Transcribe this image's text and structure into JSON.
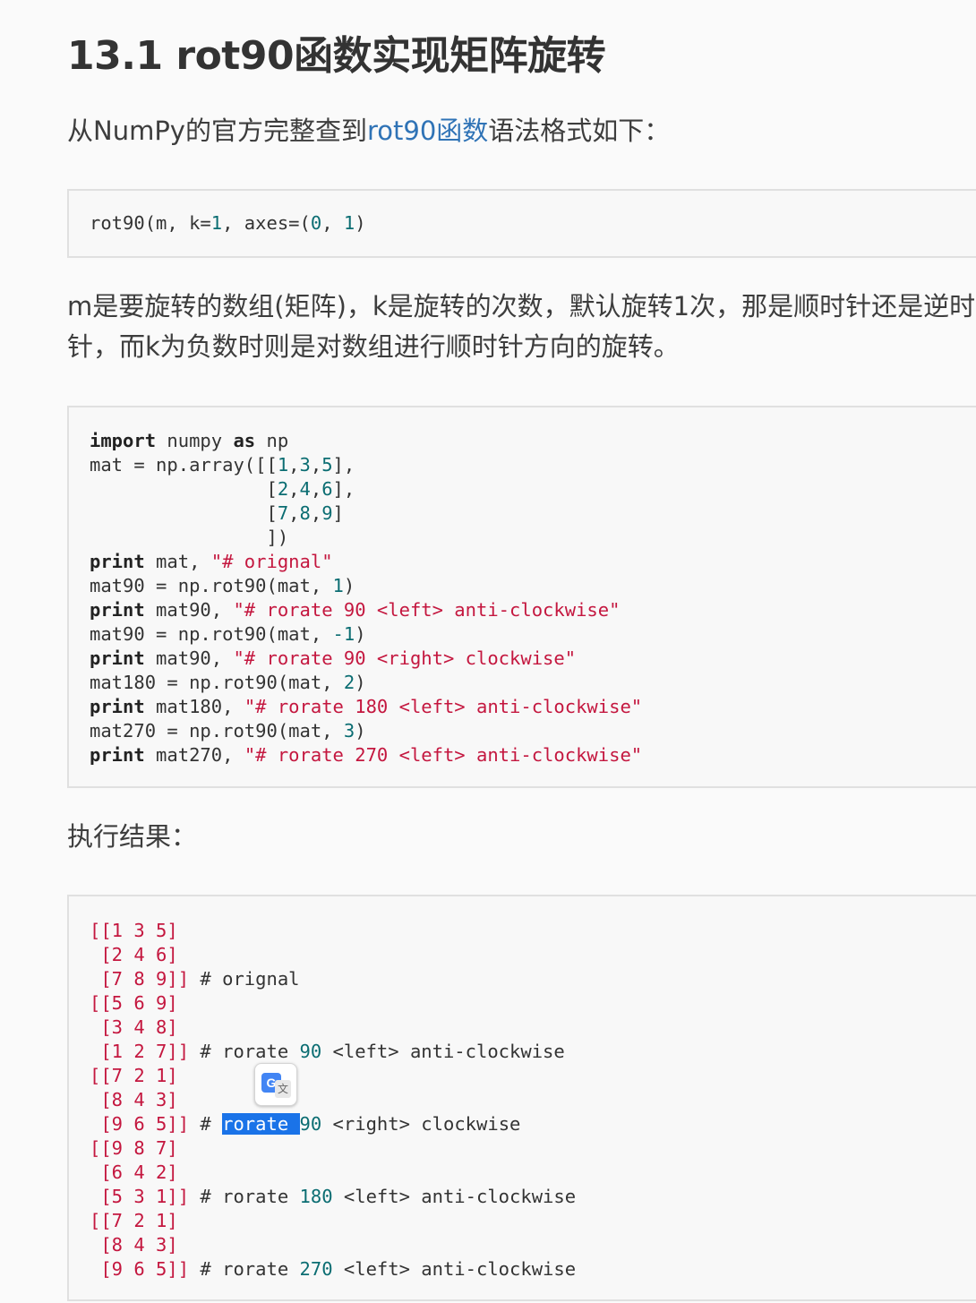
{
  "heading": "13.1 rot90函数实现矩阵旋转",
  "intro": {
    "before": "从NumPy的官方完整查到",
    "link": "rot90函数",
    "after": "语法格式如下："
  },
  "description": {
    "line1": "m是要旋转的数组(矩阵)，k是旋转的次数，默认旋转1次，那是顺时针还是逆时",
    "line2": "针，而k为负数时则是对数组进行顺时针方向的旋转。"
  },
  "result_label": "执行结果：",
  "syntax_code": {
    "fn": "rot90(m, k=",
    "k": "1",
    "axes": ", axes=(",
    "a0": "0",
    "sep": ", ",
    "a1": "1",
    "end": ")"
  },
  "example_code": {
    "l1_kw1": "import",
    "l1_mid": " numpy ",
    "l1_kw2": "as",
    "l1_end": " np",
    "l2_a": "mat = np.array([[",
    "l2_n1": "1",
    "l2_c1": ",",
    "l2_n2": "3",
    "l2_c2": ",",
    "l2_n3": "5",
    "l2_e": "],",
    "l3_a": "                [",
    "l3_n1": "2",
    "l3_c1": ",",
    "l3_n2": "4",
    "l3_c2": ",",
    "l3_n3": "6",
    "l3_e": "],",
    "l4_a": "                [",
    "l4_n1": "7",
    "l4_c1": ",",
    "l4_n2": "8",
    "l4_c2": ",",
    "l4_n3": "9",
    "l4_e": "]",
    "l5": "                ])",
    "l6_kw": "print",
    "l6_mid": " mat, ",
    "l6_str": "\"# orignal\"",
    "l7_a": "mat90 = np.rot90(mat, ",
    "l7_n": "1",
    "l7_e": ")",
    "l8_kw": "print",
    "l8_mid": " mat90, ",
    "l8_str": "\"# rorate 90 <left> anti-clockwise\"",
    "l9_a": "mat90 = np.rot90(mat, ",
    "l9_n": "-1",
    "l9_e": ")",
    "l10_kw": "print",
    "l10_mid": " mat90, ",
    "l10_str": "\"# rorate 90 <right> clockwise\"",
    "l11_a": "mat180 = np.rot90(mat, ",
    "l11_n": "2",
    "l11_e": ")",
    "l12_kw": "print",
    "l12_mid": " mat180, ",
    "l12_str": "\"# rorate 180 <left> anti-clockwise\"",
    "l13_a": "mat270 = np.rot90(mat, ",
    "l13_n": "3",
    "l13_e": ")",
    "l14_kw": "print",
    "l14_mid": " mat270, ",
    "l14_str": "\"# rorate 270 <left> anti-clockwise\""
  },
  "output_code": {
    "r1": "[[1 3 5]",
    "r2": " [2 4 6]",
    "r3": " [7 8 9]]",
    "c3": " # orignal",
    "r4": "[[5 6 9]",
    "r5": " [3 4 8]",
    "r6": " [1 2 7]]",
    "c6a": " # rorate ",
    "c6n": "90",
    "c6b": " <left> anti-clockwise",
    "r7": "[[7 2 1]",
    "r8": " [8 4 3]",
    "r9": " [9 6 5]]",
    "c9a": " # ",
    "c9sel": "rorate ",
    "c9n": "90",
    "c9b": " <right> clockwise",
    "r10": "[[9 8 7]",
    "r11": " [6 4 2]",
    "r12": " [5 3 1]]",
    "c12a": " # rorate ",
    "c12n": "180",
    "c12b": " <left> anti-clockwise",
    "r13": "[[7 2 1]",
    "r14": " [8 4 3]",
    "r15": " [9 6 5]]",
    "c15a": " # rorate ",
    "c15n": "270",
    "c15b": " <left> anti-clockwise"
  },
  "translate_popup": {
    "g": "G",
    "wen": "文"
  }
}
